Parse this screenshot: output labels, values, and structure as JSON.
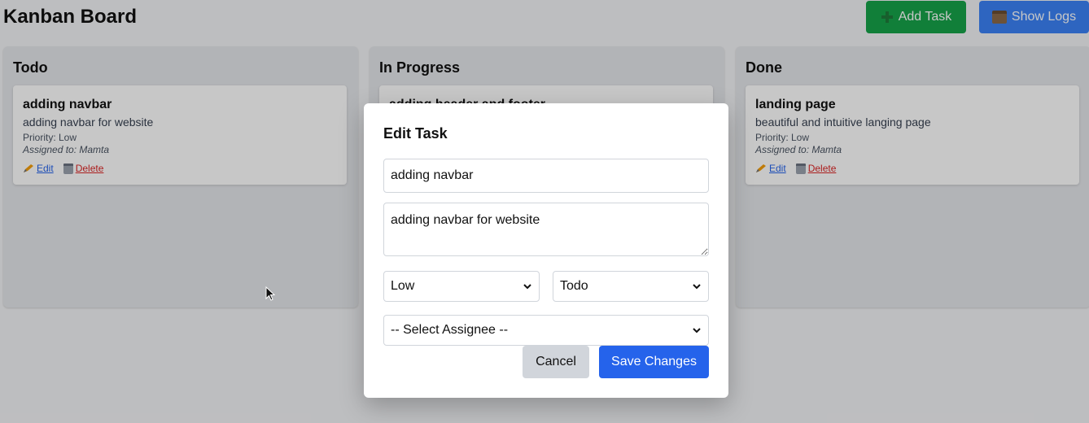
{
  "header": {
    "title": "Kanban Board",
    "add_task_label": "Add Task",
    "show_logs_label": "Show Logs"
  },
  "columns": [
    {
      "title": "Todo",
      "cards": [
        {
          "title": "adding navbar",
          "description": "adding navbar for website",
          "priority": "Priority: Low",
          "assigned": "Assigned to: Mamta",
          "edit_label": "Edit",
          "delete_label": "Delete"
        }
      ]
    },
    {
      "title": "In Progress",
      "cards": [
        {
          "title": "adding header and footer"
        }
      ]
    },
    {
      "title": "Done",
      "cards": [
        {
          "title": "landing page",
          "description": "beautiful and intuitive langing page",
          "priority": "Priority: Low",
          "assigned": "Assigned to: Mamta",
          "edit_label": "Edit",
          "delete_label": "Delete"
        }
      ]
    }
  ],
  "modal": {
    "title": "Edit Task",
    "task_title_value": "adding navbar",
    "task_description_value": "adding navbar for website",
    "priority_selected": "Low",
    "status_selected": "Todo",
    "assignee_selected": "-- Select Assignee --",
    "cancel_label": "Cancel",
    "save_label": "Save Changes"
  },
  "colors": {
    "add_button": "#16a34a",
    "logs_button": "#3b82f6",
    "save_button": "#2563eb",
    "edit_link": "#2563eb",
    "delete_link": "#dc2626"
  },
  "icons": {
    "add": "plus-icon",
    "logs": "box-icon",
    "edit": "pencil-icon",
    "delete": "trash-icon"
  }
}
